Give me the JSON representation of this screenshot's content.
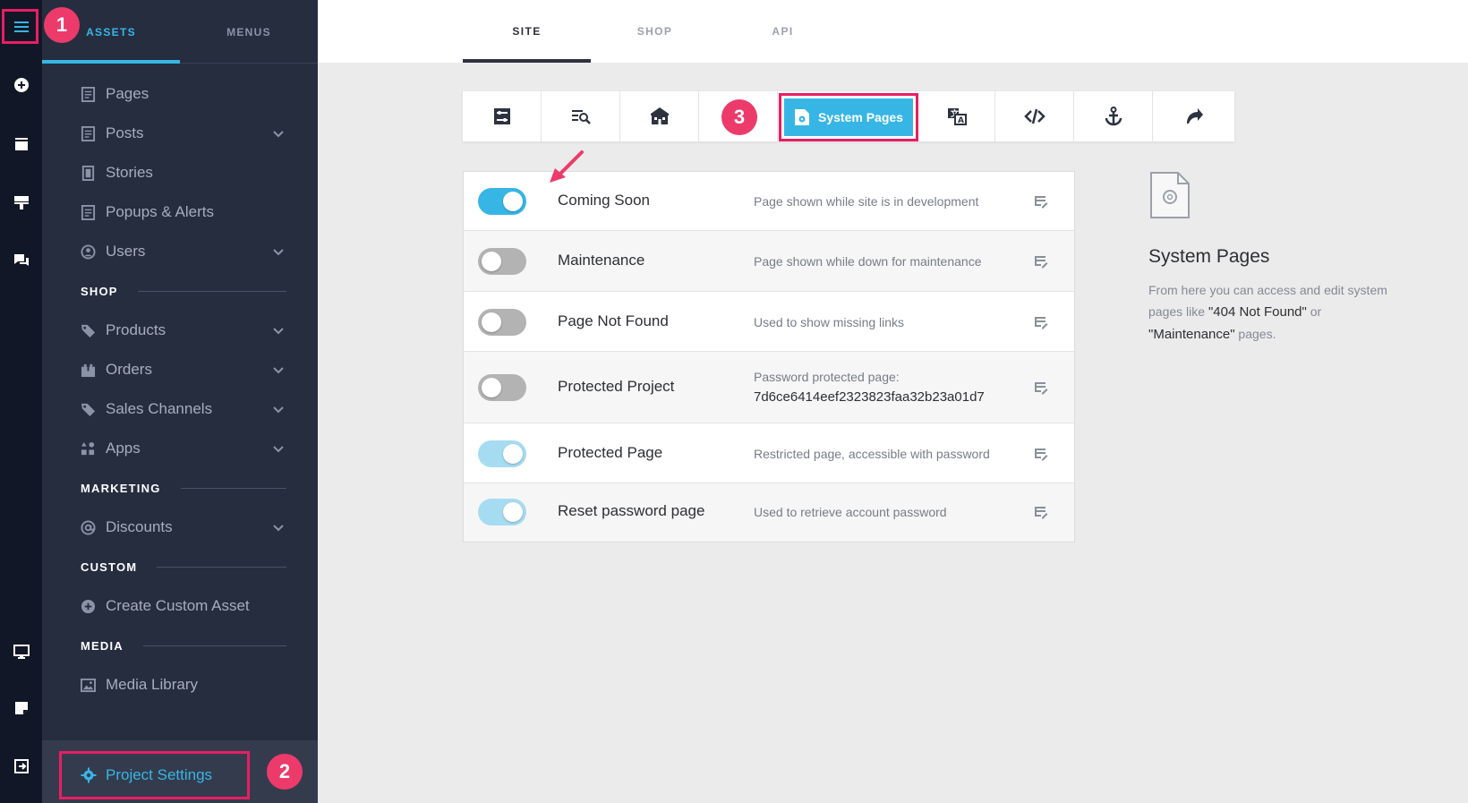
{
  "sidebar": {
    "tabs": [
      {
        "label": "ASSETS",
        "active": true
      },
      {
        "label": "MENUS",
        "active": false
      }
    ],
    "items": [
      {
        "label": "Pages",
        "icon": "page-icon",
        "has_chevron": false
      },
      {
        "label": "Posts",
        "icon": "page-icon",
        "has_chevron": true
      },
      {
        "label": "Stories",
        "icon": "story-icon",
        "has_chevron": false
      },
      {
        "label": "Popups & Alerts",
        "icon": "page-icon",
        "has_chevron": false
      },
      {
        "label": "Users",
        "icon": "user-icon",
        "has_chevron": true
      },
      {
        "label": "Products",
        "icon": "tag-icon",
        "has_chevron": true
      },
      {
        "label": "Orders",
        "icon": "box-icon",
        "has_chevron": true
      },
      {
        "label": "Sales Channels",
        "icon": "tag-icon",
        "has_chevron": true
      },
      {
        "label": "Apps",
        "icon": "apps-icon",
        "has_chevron": true
      },
      {
        "label": "Discounts",
        "icon": "at-icon",
        "has_chevron": true
      },
      {
        "label": "Create Custom Asset",
        "icon": "plus-circle-icon",
        "has_chevron": false
      },
      {
        "label": "Media Library",
        "icon": "image-icon",
        "has_chevron": false
      }
    ],
    "sections": [
      {
        "label": "SHOP"
      },
      {
        "label": "MARKETING"
      },
      {
        "label": "CUSTOM"
      },
      {
        "label": "MEDIA"
      }
    ],
    "project_settings": "Project Settings"
  },
  "top_tabs": [
    {
      "label": "SITE",
      "active": true
    },
    {
      "label": "SHOP",
      "active": false
    },
    {
      "label": "API",
      "active": false
    }
  ],
  "toolbar": {
    "active_label": "System Pages",
    "icons": [
      "settings-sliders-icon",
      "seo-search-icon",
      "business-icon",
      "system-pages-icon",
      "translate-icon",
      "code-icon",
      "anchor-icon",
      "redirect-icon"
    ]
  },
  "system_pages": [
    {
      "name": "Coming Soon",
      "description": "Page shown while site is in development",
      "hash": "",
      "state": "on"
    },
    {
      "name": "Maintenance",
      "description": "Page shown while down for maintenance",
      "hash": "",
      "state": "off"
    },
    {
      "name": "Page Not Found",
      "description": "Used to show missing links",
      "hash": "",
      "state": "off"
    },
    {
      "name": "Protected Project",
      "description": "Password protected page:",
      "hash": "7d6ce6414eef2323823faa32b23a01d7",
      "state": "off"
    },
    {
      "name": "Protected Page",
      "description": "Restricted page, accessible with password",
      "hash": "",
      "state": "disabled-on"
    },
    {
      "name": "Reset password page",
      "description": "Used to retrieve account password",
      "hash": "",
      "state": "disabled-on"
    }
  ],
  "info": {
    "title": "System Pages",
    "text_1": "From here you can access and edit system pages like ",
    "quote_1": "\"404 Not Found\"",
    "text_2": " or ",
    "quote_2": "\"Maintenance\"",
    "text_3": " pages."
  },
  "callouts": [
    "1",
    "2",
    "3"
  ],
  "colors": {
    "accent": "#37b6e6",
    "highlight": "#e91e63",
    "sidebar_bg": "#262d3f",
    "rail_bg": "#111726"
  }
}
